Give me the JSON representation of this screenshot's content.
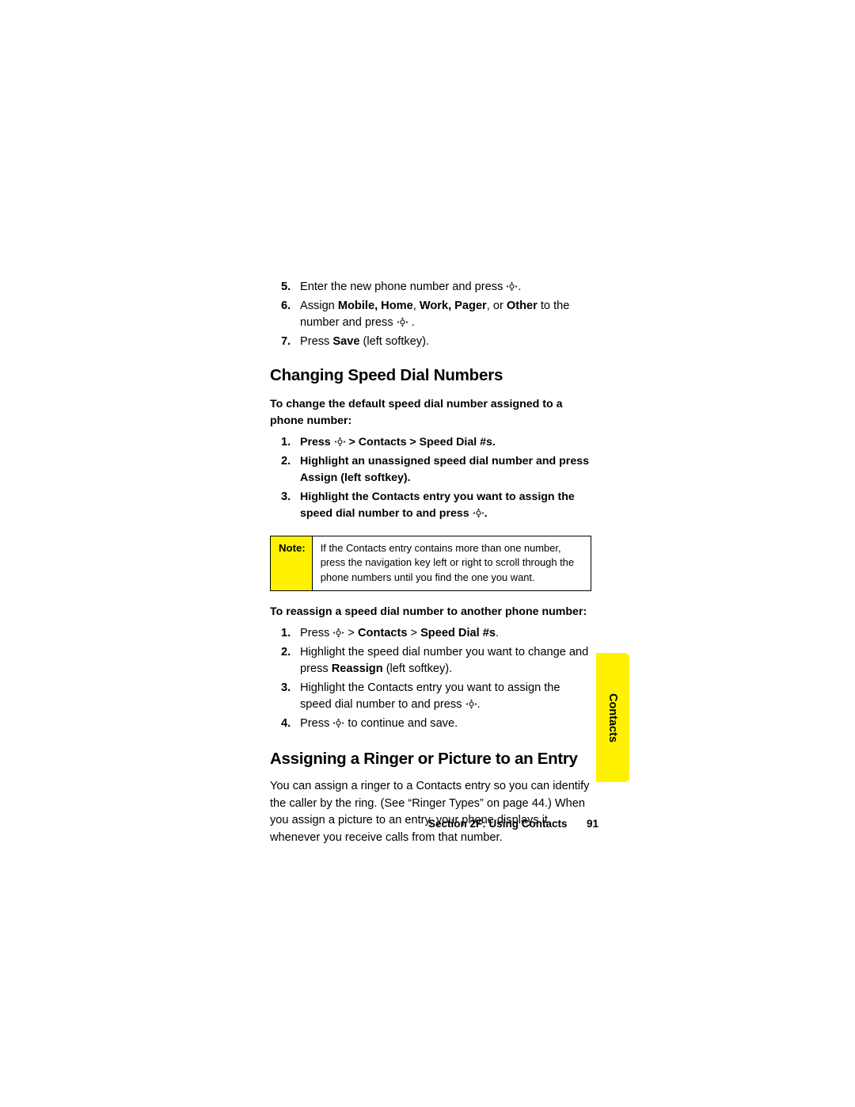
{
  "page": {
    "top_steps": [
      {
        "num": "5.",
        "html": "Enter the new phone number and press <span class=\"navkey-slot\"></span>."
      },
      {
        "num": "6.",
        "html": "Assign <b>Mobile, Home</b>, <b>Work, Pager</b>, or <b>Other</b> to the number and press <span class=\"navkey-slot\"></span> ."
      },
      {
        "num": "7.",
        "html": "Press <b>Save</b> (left softkey)."
      }
    ],
    "heading_speed_dial": "Changing Speed Dial Numbers",
    "sub_change_default": "To change the default speed dial number assigned to a phone number:",
    "change_steps": [
      {
        "num": "1.",
        "html": "Press <span class=\"navkey-slot\"></span> &gt; <b>Contacts</b> &gt; <b>Speed Dial #s</b>."
      },
      {
        "num": "2.",
        "html": "Highlight an unassigned speed dial number and press <b>Assign</b> (left softkey)."
      },
      {
        "num": "3.",
        "html": "Highlight the Contacts entry you want to assign the speed dial number to and press <span class=\"navkey-slot\"></span>."
      }
    ],
    "note": {
      "label": "Note:",
      "text": "If the Contacts entry contains more than one number, press the navigation key left or right to scroll through the phone numbers until you find the one you want."
    },
    "sub_reassign": "To reassign a speed dial number to another phone number:",
    "reassign_steps": [
      {
        "num": "1.",
        "html": "Press <span class=\"navkey-slot\"></span> &gt; <b>Contacts</b> &gt; <b>Speed Dial #s</b>."
      },
      {
        "num": "2.",
        "html": "Highlight the speed dial number you want to change and press <b>Reassign</b> (left softkey)."
      },
      {
        "num": "3.",
        "html": "Highlight the Contacts entry you want to assign the speed dial number to and press <span class=\"navkey-slot\"></span>."
      },
      {
        "num": "4.",
        "html": "Press <span class=\"navkey-slot\"></span> to continue and save."
      }
    ],
    "heading_ringer": "Assigning a Ringer or Picture to an Entry",
    "ringer_body": "You can assign a ringer to a Contacts entry so you can identify the caller by the ring. (See “Ringer Types” on page 44.) When you assign a picture to an entry, your phone displays it whenever you receive calls from that number.",
    "side_tab_label": "Contacts",
    "footer": {
      "section": "Section 2F: Using Contacts",
      "page_number": "91"
    },
    "colors": {
      "highlight_yellow": "#fff200",
      "text": "#000000",
      "background": "#ffffff"
    },
    "icons": {
      "navigation_key": "navigation-key-icon"
    }
  }
}
